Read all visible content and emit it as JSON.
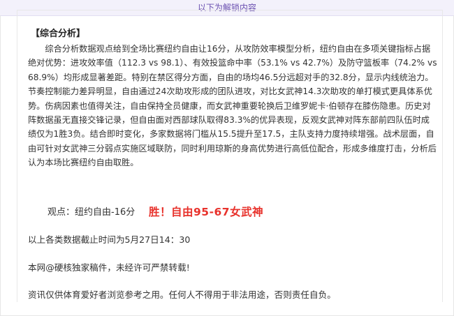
{
  "banner": {
    "text": "以下为解锁内容"
  },
  "article": {
    "section_title": "【综合分析】",
    "paragraph": "综合分析数据观点给到全场比赛纽约自由让16分，从攻防效率模型分析，纽约自由在多项关键指标占据绝对优势：进攻效率值（112.3 vs 98.1）、有效投篮命中率（53.1% vs 42.7%）及防守篮板率（74.2% vs 68.9%）均形成显著差距。特别在禁区得分方面，自由的场均46.5分远超对手的32.8分，显示内线统治力。节奏控制能力差异明显，自由通过24次助攻形成的团队进攻，对比女武神14.3次助攻的单打模式更具体系优势。伤病因素也值得关注，自由保持全员健康，而女武神重要轮换后卫维罗妮卡·伯顿存在膝伤隐患。历史对阵数据虽无直接交锋记录，但自由面对西部球队取得83.3%的优异表现，反观女武神对阵东部前四队伍时成绩仅为1胜3负。结合即时变化，多家数据将门槛从15.5提升至17.5，主队支持力度持续增强。战术层面，自由可针对女武神三分弱点实施区域联防，同时利用琼斯的身高优势进行高低位配合，形成多维度打击，分析后认为本场比赛纽约自由取胜。",
    "pick_label": "观点：纽约自由-16分",
    "pick_result": "胜！自由95-67女武神",
    "data_cutoff": "以上各类数据截止时间为5月27日14：30",
    "copyright": "本网@硬核独家稿件，未经许可严禁转载!",
    "disclaimer": "资讯仅供体育爱好者浏览参考之用。任何人不得用于非法用途，否则责任自负。"
  },
  "colors": {
    "banner_bg": "#f3f1fb",
    "banner_text": "#6a4fb0",
    "result_red": "#e8322c",
    "body_text": "#333333"
  }
}
